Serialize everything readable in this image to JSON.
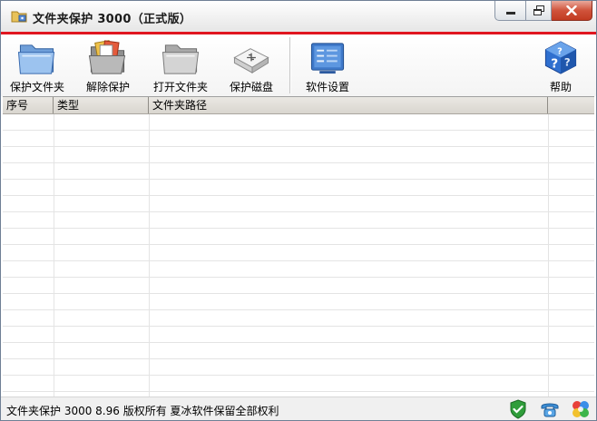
{
  "window": {
    "title": "文件夹保护 3000（正式版）"
  },
  "toolbar": {
    "protect_folder": "保护文件夹",
    "unprotect": "解除保护",
    "open_folder": "打开文件夹",
    "protect_disk": "保护磁盘",
    "settings": "软件设置",
    "help": "帮助"
  },
  "table": {
    "columns": [
      "序号",
      "类型",
      "文件夹路径",
      ""
    ],
    "rows": []
  },
  "status": {
    "text": "文件夹保护 3000 8.96 版权所有 夏冰软件保留全部权利"
  },
  "colors": {
    "accent_red": "#e0161f",
    "close_button": "#c23b21"
  },
  "icons": {
    "app": "folder-lock-icon",
    "protect_folder": "blue-folder-icon",
    "unprotect": "open-folder-documents-icon",
    "open_folder": "gray-folder-icon",
    "protect_disk": "usb-disk-icon",
    "settings": "settings-panel-icon",
    "help": "help-cube-icon",
    "status_shield": "shield-check-icon",
    "status_phone": "phone-icon",
    "status_pinwheel": "pinwheel-icon"
  }
}
